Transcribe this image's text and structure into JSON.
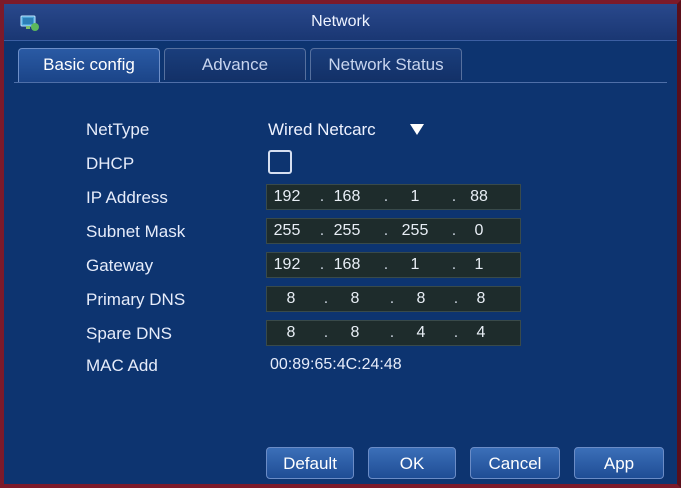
{
  "window": {
    "title": "Network",
    "icon": "network-monitor-icon"
  },
  "tabs": [
    {
      "label": "Basic config",
      "active": true
    },
    {
      "label": "Advance",
      "active": false
    },
    {
      "label": "Network Status",
      "active": false
    }
  ],
  "fields": {
    "nettype": {
      "label": "NetType",
      "value": "Wired Netcarc"
    },
    "dhcp": {
      "label": "DHCP",
      "checked": false
    },
    "ip_address": {
      "label": "IP Address",
      "octets": [
        "192",
        "168",
        "1",
        "88"
      ]
    },
    "subnet_mask": {
      "label": "Subnet Mask",
      "octets": [
        "255",
        "255",
        "255",
        "0"
      ]
    },
    "gateway": {
      "label": "Gateway",
      "octets": [
        "192",
        "168",
        "1",
        "1"
      ]
    },
    "primary_dns": {
      "label": "Primary DNS",
      "octets": [
        "8",
        "8",
        "8",
        "8"
      ]
    },
    "spare_dns": {
      "label": "Spare DNS",
      "octets": [
        "8",
        "8",
        "4",
        "4"
      ]
    },
    "mac": {
      "label": "MAC Add",
      "value": "00:89:65:4C:24:48"
    }
  },
  "buttons": {
    "default": "Default",
    "ok": "OK",
    "cancel": "Cancel",
    "apply": "App"
  },
  "colors": {
    "panel": "#0d3470",
    "border": "#7c1a2a",
    "ip_field": "#1e2c2c",
    "button": "#2d5ea8"
  }
}
